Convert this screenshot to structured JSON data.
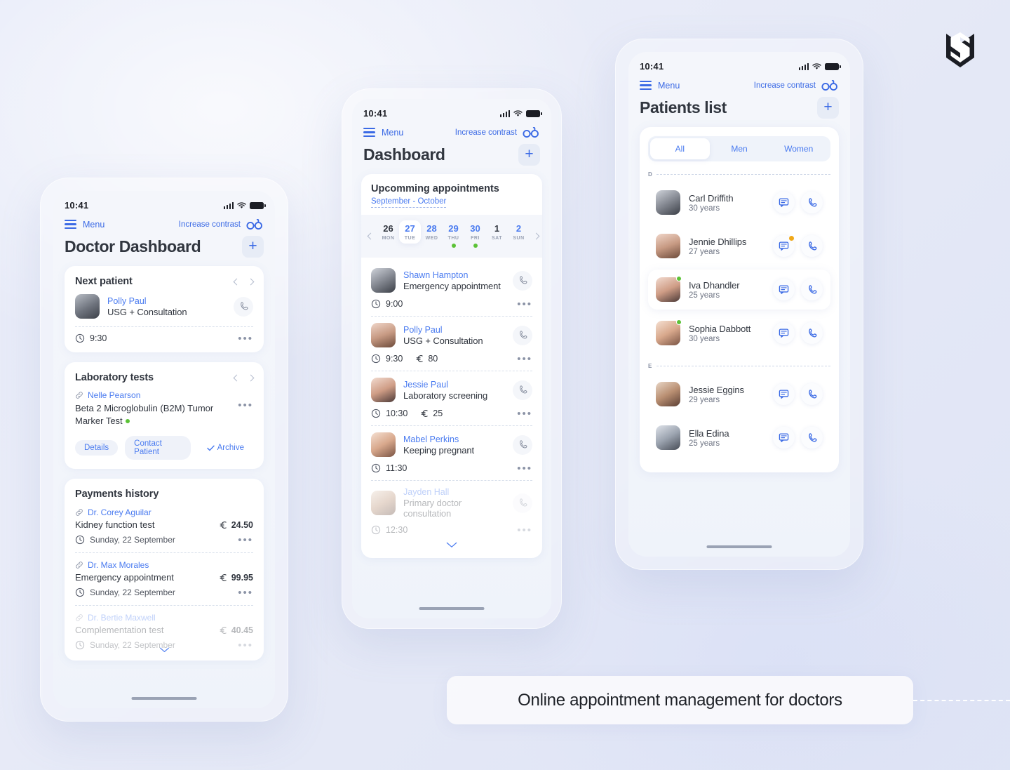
{
  "background": {
    "accent": "#3b6ae5",
    "text_dark": "#31363f",
    "green": "#5bc236",
    "orange": "#f0a818"
  },
  "logo": {
    "name": "ms-monogram-logo"
  },
  "caption": {
    "text": "Online appointment management for doctors"
  },
  "shared": {
    "status_time": "10:41",
    "menu_label": "Menu",
    "contrast_label": "Increase contrast"
  },
  "phone1": {
    "title": "Doctor Dashboard",
    "add_label": "+",
    "next_patient": {
      "title": "Next patient",
      "patient_name": "Polly Paul",
      "service": "USG + Consultation",
      "time": "9:30"
    },
    "laboratory": {
      "title": "Laboratory tests",
      "doctor": "Nelle Pearson",
      "test_name": "Beta 2 Microglobulin (B2M) Tumor Marker Test",
      "pills": [
        "Details",
        "Contact Patient",
        "Archive"
      ]
    },
    "payments": {
      "title": "Payments history",
      "items": [
        {
          "doctor": "Dr. Corey Aguilar",
          "desc": "Kidney function test",
          "currency": "€",
          "amount": "24.50",
          "date": "Sunday, 22 September"
        },
        {
          "doctor": "Dr. Max Morales",
          "desc": "Emergency appointment",
          "currency": "€",
          "amount": "99.95",
          "date": "Sunday, 22 September"
        },
        {
          "doctor": "Dr. Bertie Maxwell",
          "desc": "Complementation test",
          "currency": "€",
          "amount": "40.45",
          "date": "Sunday, 22 September"
        }
      ]
    }
  },
  "phone2": {
    "title": "Dashboard",
    "add_label": "+",
    "appointments": {
      "title": "Upcomming appointments",
      "subtitle": "September - October",
      "calendar": [
        {
          "num": "26",
          "day": "MON",
          "dim": true,
          "active": false,
          "dot": false
        },
        {
          "num": "27",
          "day": "TUE",
          "dim": false,
          "active": true,
          "dot": false
        },
        {
          "num": "28",
          "day": "WED",
          "dim": false,
          "active": false,
          "dot": false
        },
        {
          "num": "29",
          "day": "THU",
          "dim": false,
          "active": false,
          "dot": true
        },
        {
          "num": "30",
          "day": "FRI",
          "dim": false,
          "active": false,
          "dot": true
        },
        {
          "num": "1",
          "day": "SAT",
          "dim": true,
          "active": false,
          "dot": false
        },
        {
          "num": "2",
          "day": "SUN",
          "dim": false,
          "active": false,
          "dot": false
        }
      ],
      "items": [
        {
          "name": "Shawn Hampton",
          "service": "Emergency appointment",
          "time": "9:00",
          "currency": "",
          "price": ""
        },
        {
          "name": "Polly Paul",
          "service": "USG + Consultation",
          "time": "9:30",
          "currency": "€",
          "price": "80"
        },
        {
          "name": "Jessie Paul",
          "service": "Laboratory screening",
          "time": "10:30",
          "currency": "€",
          "price": "25"
        },
        {
          "name": "Mabel Perkins",
          "service": "Keeping pregnant",
          "time": "11:30",
          "currency": "",
          "price": ""
        },
        {
          "name": "Jayden Hall",
          "service": "Primary doctor consultation",
          "time": "12:30",
          "currency": "",
          "price": ""
        }
      ]
    }
  },
  "phone3": {
    "title": "Patients list",
    "add_label": "+",
    "tabs": [
      {
        "label": "All",
        "active": true
      },
      {
        "label": "Men",
        "active": false
      },
      {
        "label": "Women",
        "active": false
      }
    ],
    "sections": [
      {
        "letter": "D",
        "patients": [
          {
            "name": "Carl Driffith",
            "age": "30 years",
            "online": false,
            "raised": false,
            "notif": false
          },
          {
            "name": "Jennie Dhillips",
            "age": "27 years",
            "online": false,
            "raised": false,
            "notif": true
          },
          {
            "name": "Iva Dhandler",
            "age": "25 years",
            "online": true,
            "raised": true,
            "notif": false
          },
          {
            "name": "Sophia Dabbott",
            "age": "30 years",
            "online": true,
            "raised": false,
            "notif": false
          }
        ]
      },
      {
        "letter": "E",
        "patients": [
          {
            "name": "Jessie Eggins",
            "age": "29 years",
            "online": false,
            "raised": false,
            "notif": false
          },
          {
            "name": "Ella Edina",
            "age": "25 years",
            "online": false,
            "raised": false,
            "notif": false
          }
        ]
      }
    ]
  }
}
